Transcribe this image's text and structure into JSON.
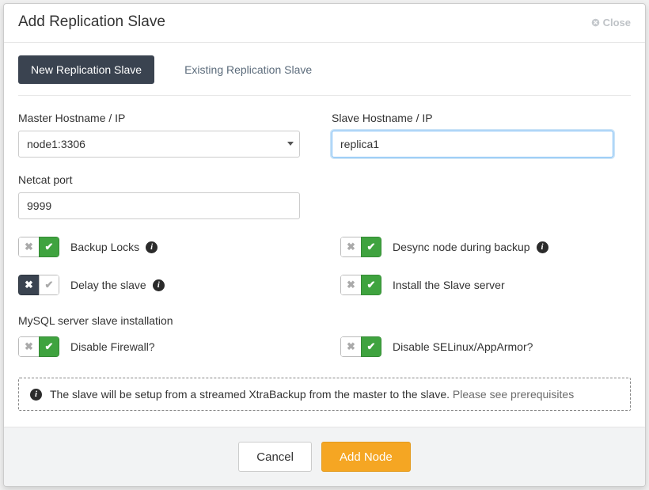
{
  "header": {
    "title": "Add Replication Slave",
    "close_label": "Close"
  },
  "tabs": {
    "new_label": "New Replication Slave",
    "existing_label": "Existing Replication Slave"
  },
  "form": {
    "master_label": "Master Hostname / IP",
    "master_value": "node1:3306",
    "slave_label": "Slave Hostname / IP",
    "slave_value": "replica1",
    "netcat_label": "Netcat port",
    "netcat_value": "9999"
  },
  "toggles": {
    "backup_locks": {
      "label": "Backup Locks",
      "value": "on",
      "info": true
    },
    "desync": {
      "label": "Desync node during backup",
      "value": "on",
      "info": true
    },
    "delay_slave": {
      "label": "Delay the slave",
      "value": "off",
      "info": true
    },
    "install_slave": {
      "label": "Install the Slave server",
      "value": "on",
      "info": false
    }
  },
  "section": {
    "title": "MySQL server slave installation",
    "disable_firewall": {
      "label": "Disable Firewall?",
      "value": "on"
    },
    "disable_selinux": {
      "label": "Disable SELinux/AppArmor?",
      "value": "on"
    }
  },
  "notice": {
    "text": "The slave will be setup from a streamed XtraBackup from the master to the slave.",
    "link_label": "Please see prerequisites"
  },
  "footer": {
    "cancel_label": "Cancel",
    "submit_label": "Add Node"
  }
}
